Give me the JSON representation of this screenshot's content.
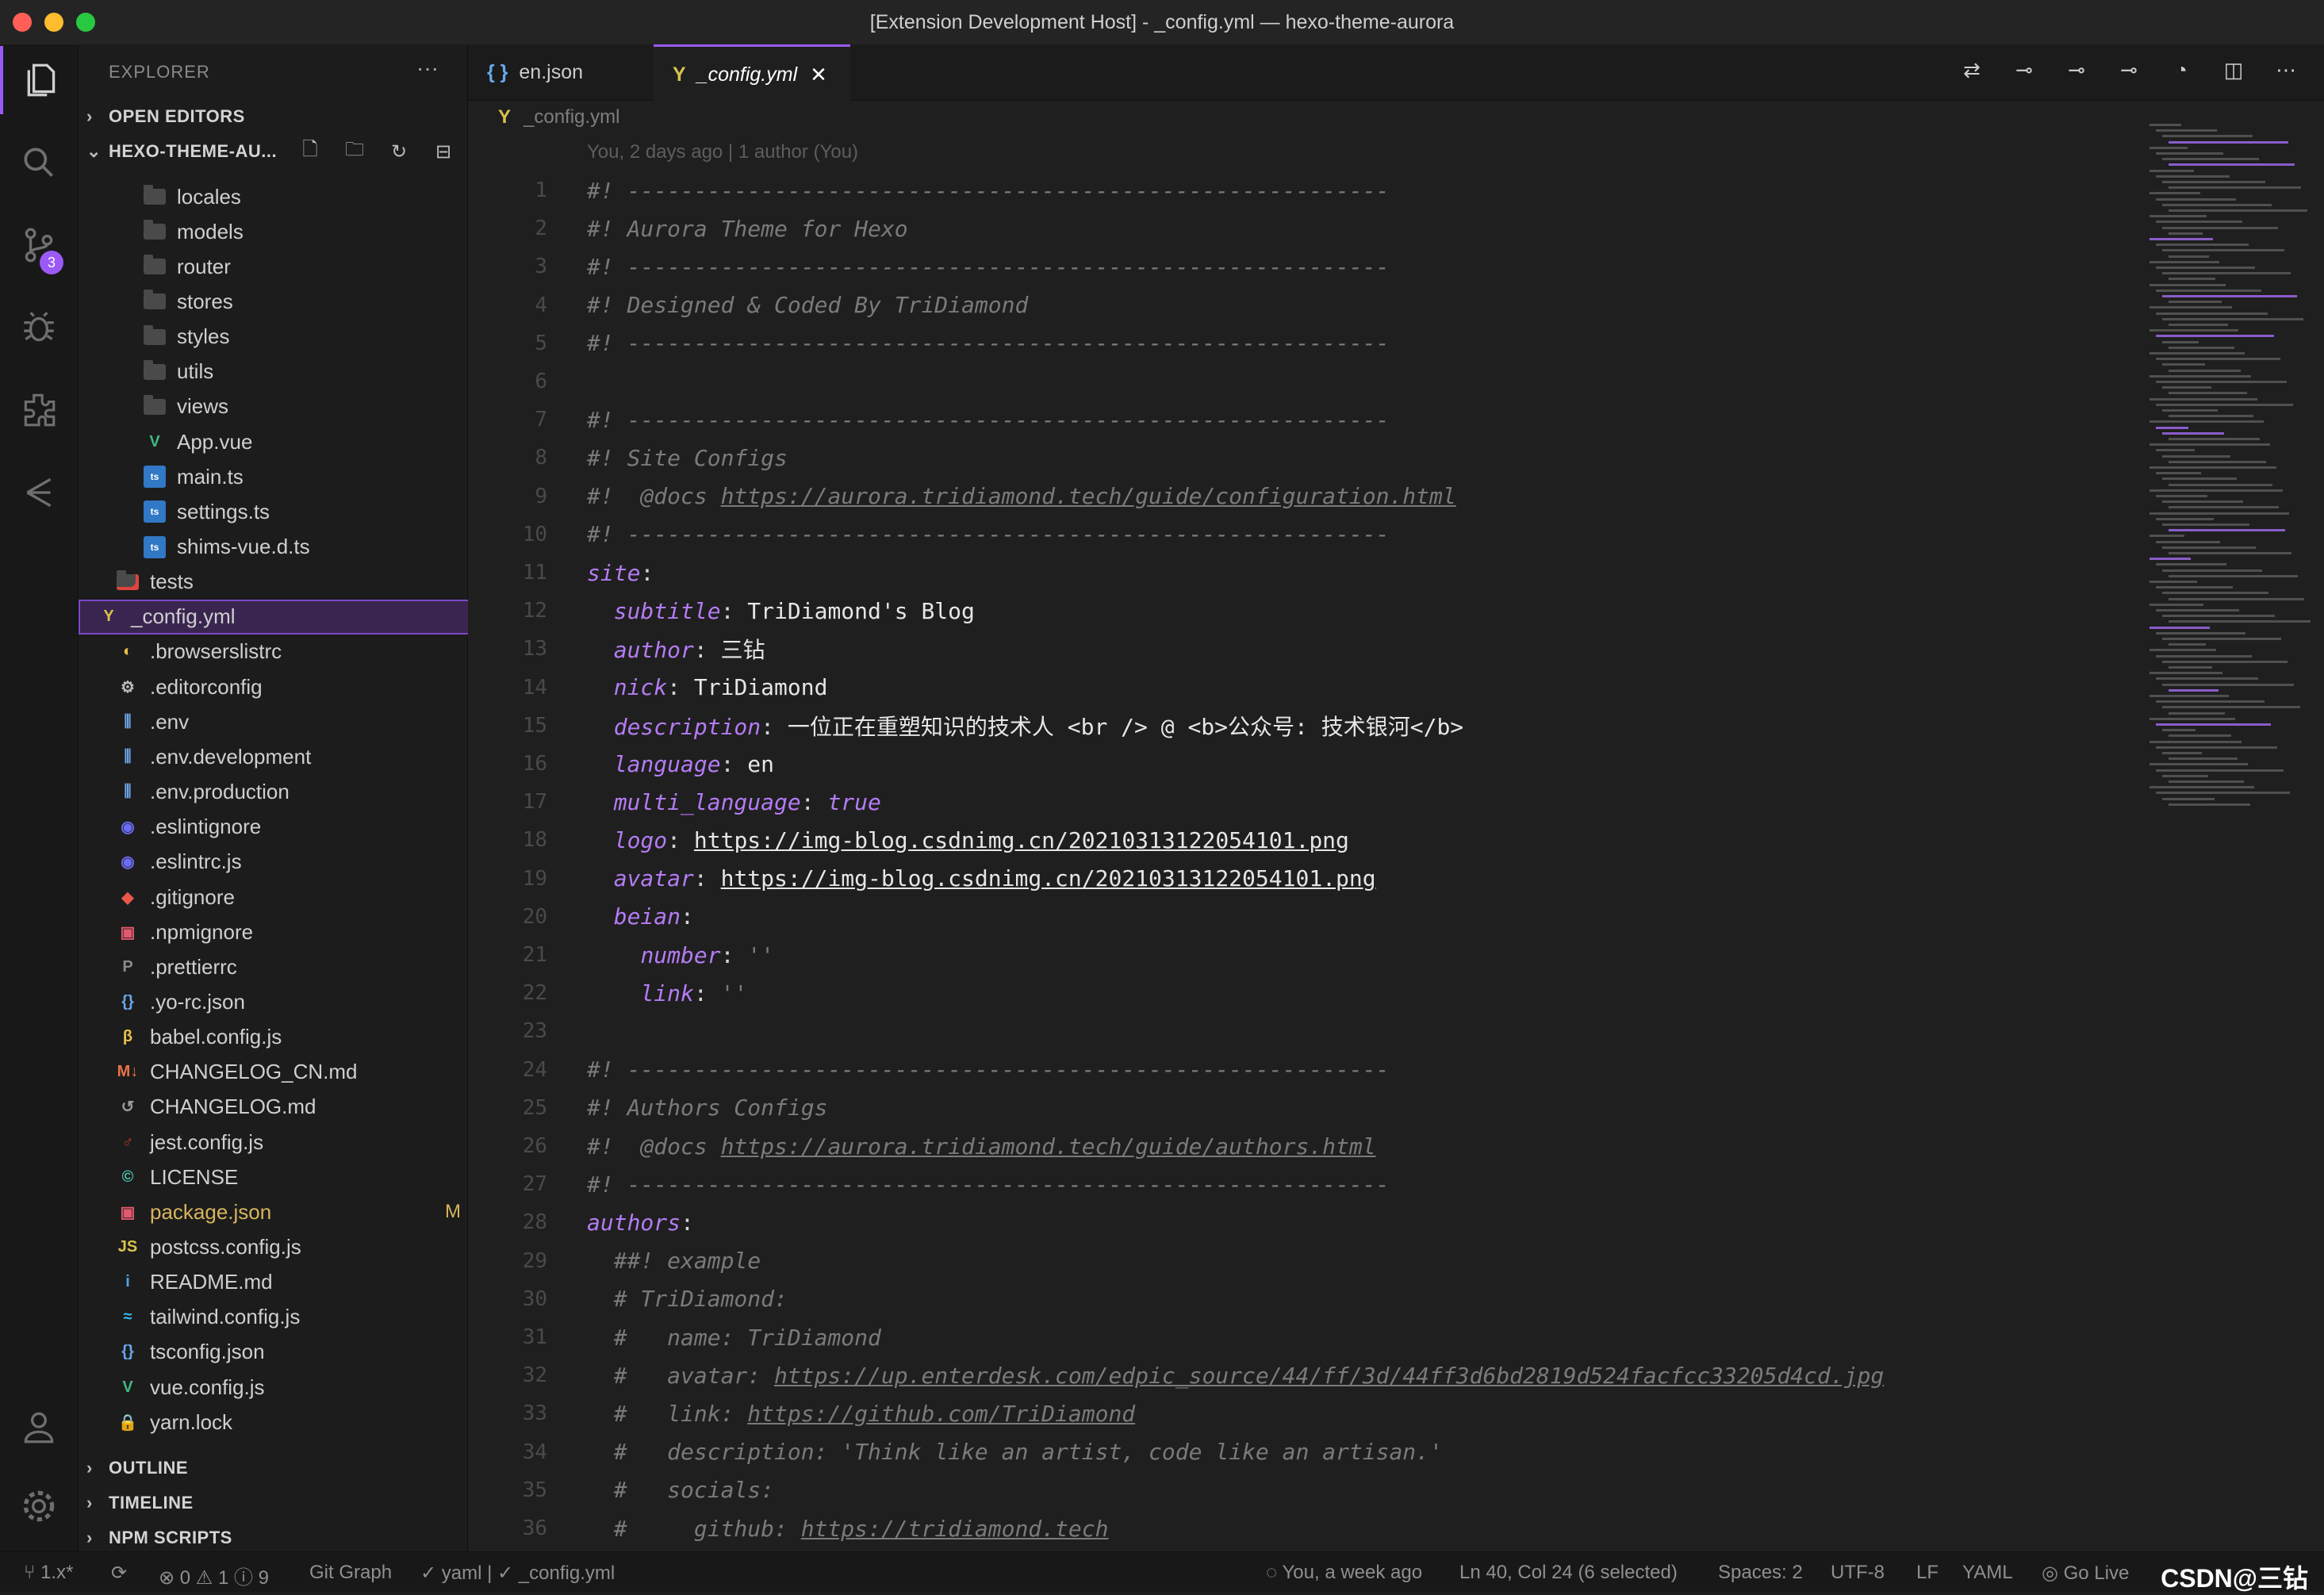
{
  "window": {
    "title": "[Extension Development Host] - _config.yml — hexo-theme-aurora"
  },
  "activity_bar": {
    "scm_badge": "3"
  },
  "explorer": {
    "title": "EXPLORER",
    "more": "···",
    "sections": {
      "open_editors": "OPEN EDITORS",
      "project": "HEXO-THEME-AU...",
      "outline": "OUTLINE",
      "timeline": "TIMELINE",
      "npm": "NPM SCRIPTS"
    },
    "files": [
      {
        "name": "locales",
        "kind": "folder"
      },
      {
        "name": "models",
        "kind": "folder"
      },
      {
        "name": "router",
        "kind": "folder"
      },
      {
        "name": "stores",
        "kind": "folder"
      },
      {
        "name": "styles",
        "kind": "folder"
      },
      {
        "name": "utils",
        "kind": "folder"
      },
      {
        "name": "views",
        "kind": "folder"
      },
      {
        "name": "App.vue",
        "kind": "vue",
        "icon": "V",
        "color": "#41b883"
      },
      {
        "name": "main.ts",
        "kind": "ts",
        "icon": "ts",
        "color": "#3178c6"
      },
      {
        "name": "settings.ts",
        "kind": "ts",
        "icon": "ts",
        "color": "#3178c6"
      },
      {
        "name": "shims-vue.d.ts",
        "kind": "ts",
        "icon": "ts",
        "color": "#3178c6"
      },
      {
        "name": "tests",
        "kind": "folder-red"
      },
      {
        "name": "_config.yml",
        "kind": "yml",
        "icon": "Y",
        "color": "#d7c24d",
        "selected": true
      },
      {
        "name": ".browserslistrc",
        "icon": "◐",
        "color": "#e8c14d"
      },
      {
        "name": ".editorconfig",
        "icon": "⚙",
        "color": "#bbbbbb"
      },
      {
        "name": ".env",
        "icon": "⫼",
        "color": "#6aa7e8"
      },
      {
        "name": ".env.development",
        "icon": "⫼",
        "color": "#6aa7e8"
      },
      {
        "name": ".env.production",
        "icon": "⫼",
        "color": "#6aa7e8"
      },
      {
        "name": ".eslintignore",
        "icon": "◉",
        "color": "#6b6cf2"
      },
      {
        "name": ".eslintrc.js",
        "icon": "◉",
        "color": "#6b6cf2"
      },
      {
        "name": ".gitignore",
        "icon": "◆",
        "color": "#e8574a"
      },
      {
        "name": ".npmignore",
        "icon": "▣",
        "color": "#e05a6e"
      },
      {
        "name": ".prettierrc",
        "icon": "P",
        "color": "#8a8a8a"
      },
      {
        "name": ".yo-rc.json",
        "icon": "{}",
        "color": "#6aa7e8"
      },
      {
        "name": "babel.config.js",
        "icon": "β",
        "color": "#e8c14d"
      },
      {
        "name": "CHANGELOG_CN.md",
        "icon": "M↓",
        "color": "#e8734a"
      },
      {
        "name": "CHANGELOG.md",
        "icon": "↺",
        "color": "#9c9c9c"
      },
      {
        "name": "jest.config.js",
        "icon": "♂",
        "color": "#c0392b"
      },
      {
        "name": "LICENSE",
        "icon": "©",
        "color": "#4ec9b0"
      },
      {
        "name": "package.json",
        "icon": "▣",
        "color": "#e05a6e",
        "modified": "M",
        "name_color": "#d7b55c"
      },
      {
        "name": "postcss.config.js",
        "icon": "JS",
        "color": "#d7c24d"
      },
      {
        "name": "README.md",
        "icon": "i",
        "color": "#4aa7e8"
      },
      {
        "name": "tailwind.config.js",
        "icon": "≈",
        "color": "#38bdf8"
      },
      {
        "name": "tsconfig.json",
        "icon": "{}",
        "color": "#6aa7e8"
      },
      {
        "name": "vue.config.js",
        "icon": "V",
        "color": "#41b883"
      },
      {
        "name": "yarn.lock",
        "icon": "🔒",
        "color": "#5a9fd4"
      }
    ]
  },
  "tabs": [
    {
      "label": "en.json",
      "icon": "{ }"
    },
    {
      "label": "_config.yml",
      "icon": "Y",
      "active": true
    }
  ],
  "breadcrumb": "_config.yml",
  "codelens": "You, 2 days ago | 1 author (You)",
  "code_lines": [
    [
      [
        "cm",
        "#! ---------------------------------------------------------"
      ]
    ],
    [
      [
        "cm",
        "#! Aurora Theme for Hexo"
      ]
    ],
    [
      [
        "cm",
        "#! ---------------------------------------------------------"
      ]
    ],
    [
      [
        "cm",
        "#! Designed & Coded By TriDiamond"
      ]
    ],
    [
      [
        "cm",
        "#! ---------------------------------------------------------"
      ]
    ],
    [],
    [
      [
        "cm",
        "#! ---------------------------------------------------------"
      ]
    ],
    [
      [
        "cm",
        "#! Site Configs"
      ]
    ],
    [
      [
        "cm",
        "#!  @docs "
      ],
      [
        "cm url",
        "https://aurora.tridiamond.tech/guide/configuration.html"
      ]
    ],
    [
      [
        "cm",
        "#! ---------------------------------------------------------"
      ]
    ],
    [
      [
        "key",
        "site"
      ],
      [
        "txt",
        ":"
      ]
    ],
    [
      [
        "txt",
        "  "
      ],
      [
        "key",
        "subtitle"
      ],
      [
        "txt",
        ": "
      ],
      [
        "val",
        "TriDiamond's Blog"
      ]
    ],
    [
      [
        "txt",
        "  "
      ],
      [
        "key",
        "author"
      ],
      [
        "txt",
        ": "
      ],
      [
        "val",
        "三钻"
      ]
    ],
    [
      [
        "txt",
        "  "
      ],
      [
        "key",
        "nick"
      ],
      [
        "txt",
        ": "
      ],
      [
        "val",
        "TriDiamond"
      ]
    ],
    [
      [
        "txt",
        "  "
      ],
      [
        "key",
        "description"
      ],
      [
        "txt",
        ": "
      ],
      [
        "val",
        "一位正在重塑知识的技术人 <br /> @ <b>公众号: 技术银河</b>"
      ]
    ],
    [
      [
        "txt",
        "  "
      ],
      [
        "key",
        "language"
      ],
      [
        "txt",
        ": "
      ],
      [
        "val",
        "en"
      ]
    ],
    [
      [
        "txt",
        "  "
      ],
      [
        "key",
        "multi_language"
      ],
      [
        "txt",
        ": "
      ],
      [
        "bool",
        "true"
      ]
    ],
    [
      [
        "txt",
        "  "
      ],
      [
        "key",
        "logo"
      ],
      [
        "txt",
        ": "
      ],
      [
        "val url",
        "https://img-blog.csdnimg.cn/20210313122054101.png"
      ]
    ],
    [
      [
        "txt",
        "  "
      ],
      [
        "key",
        "avatar"
      ],
      [
        "txt",
        ": "
      ],
      [
        "val url",
        "https://img-blog.csdnimg.cn/20210313122054101.png"
      ]
    ],
    [
      [
        "txt",
        "  "
      ],
      [
        "key",
        "beian"
      ],
      [
        "txt",
        ":"
      ]
    ],
    [
      [
        "txt",
        "    "
      ],
      [
        "key",
        "number"
      ],
      [
        "txt",
        ": "
      ],
      [
        "cm",
        "''"
      ]
    ],
    [
      [
        "txt",
        "    "
      ],
      [
        "key",
        "link"
      ],
      [
        "txt",
        ": "
      ],
      [
        "cm",
        "''"
      ]
    ],
    [],
    [
      [
        "cm",
        "#! ---------------------------------------------------------"
      ]
    ],
    [
      [
        "cm",
        "#! Authors Configs"
      ]
    ],
    [
      [
        "cm",
        "#!  @docs "
      ],
      [
        "cm url",
        "https://aurora.tridiamond.tech/guide/authors.html"
      ]
    ],
    [
      [
        "cm",
        "#! ---------------------------------------------------------"
      ]
    ],
    [
      [
        "key",
        "authors"
      ],
      [
        "txt",
        ":"
      ]
    ],
    [
      [
        "txt",
        "  "
      ],
      [
        "cm",
        "##! example"
      ]
    ],
    [
      [
        "txt",
        "  "
      ],
      [
        "cm",
        "# TriDiamond:"
      ]
    ],
    [
      [
        "txt",
        "  "
      ],
      [
        "cm",
        "#   name: TriDiamond"
      ]
    ],
    [
      [
        "txt",
        "  "
      ],
      [
        "cm",
        "#   avatar: "
      ],
      [
        "cm url",
        "https://up.enterdesk.com/edpic_source/44/ff/3d/44ff3d6bd2819d524facfcc33205d4cd.jpg"
      ]
    ],
    [
      [
        "txt",
        "  "
      ],
      [
        "cm",
        "#   link: "
      ],
      [
        "cm url",
        "https://github.com/TriDiamond"
      ]
    ],
    [
      [
        "txt",
        "  "
      ],
      [
        "cm",
        "#   description: 'Think like an artist, code like an artisan.'"
      ]
    ],
    [
      [
        "txt",
        "  "
      ],
      [
        "cm",
        "#   socials:"
      ]
    ],
    [
      [
        "txt",
        "  "
      ],
      [
        "cm",
        "#     github: "
      ],
      [
        "cm url",
        "https://tridiamond.tech"
      ]
    ]
  ],
  "statusbar": {
    "branch": "1.x*",
    "problems": "⊗ 0 ⚠ 1 ⓘ 9",
    "git_graph": "Git Graph",
    "lang_check": "✓ yaml | ✓ _config.yml",
    "blame": "You, a week ago",
    "position": "Ln 40, Col 24 (6 selected)",
    "spaces": "Spaces: 2",
    "encoding": "UTF-8",
    "eol": "LF",
    "language": "YAML",
    "golive": "Go Live",
    "watermark": "CSDN@三钻"
  }
}
